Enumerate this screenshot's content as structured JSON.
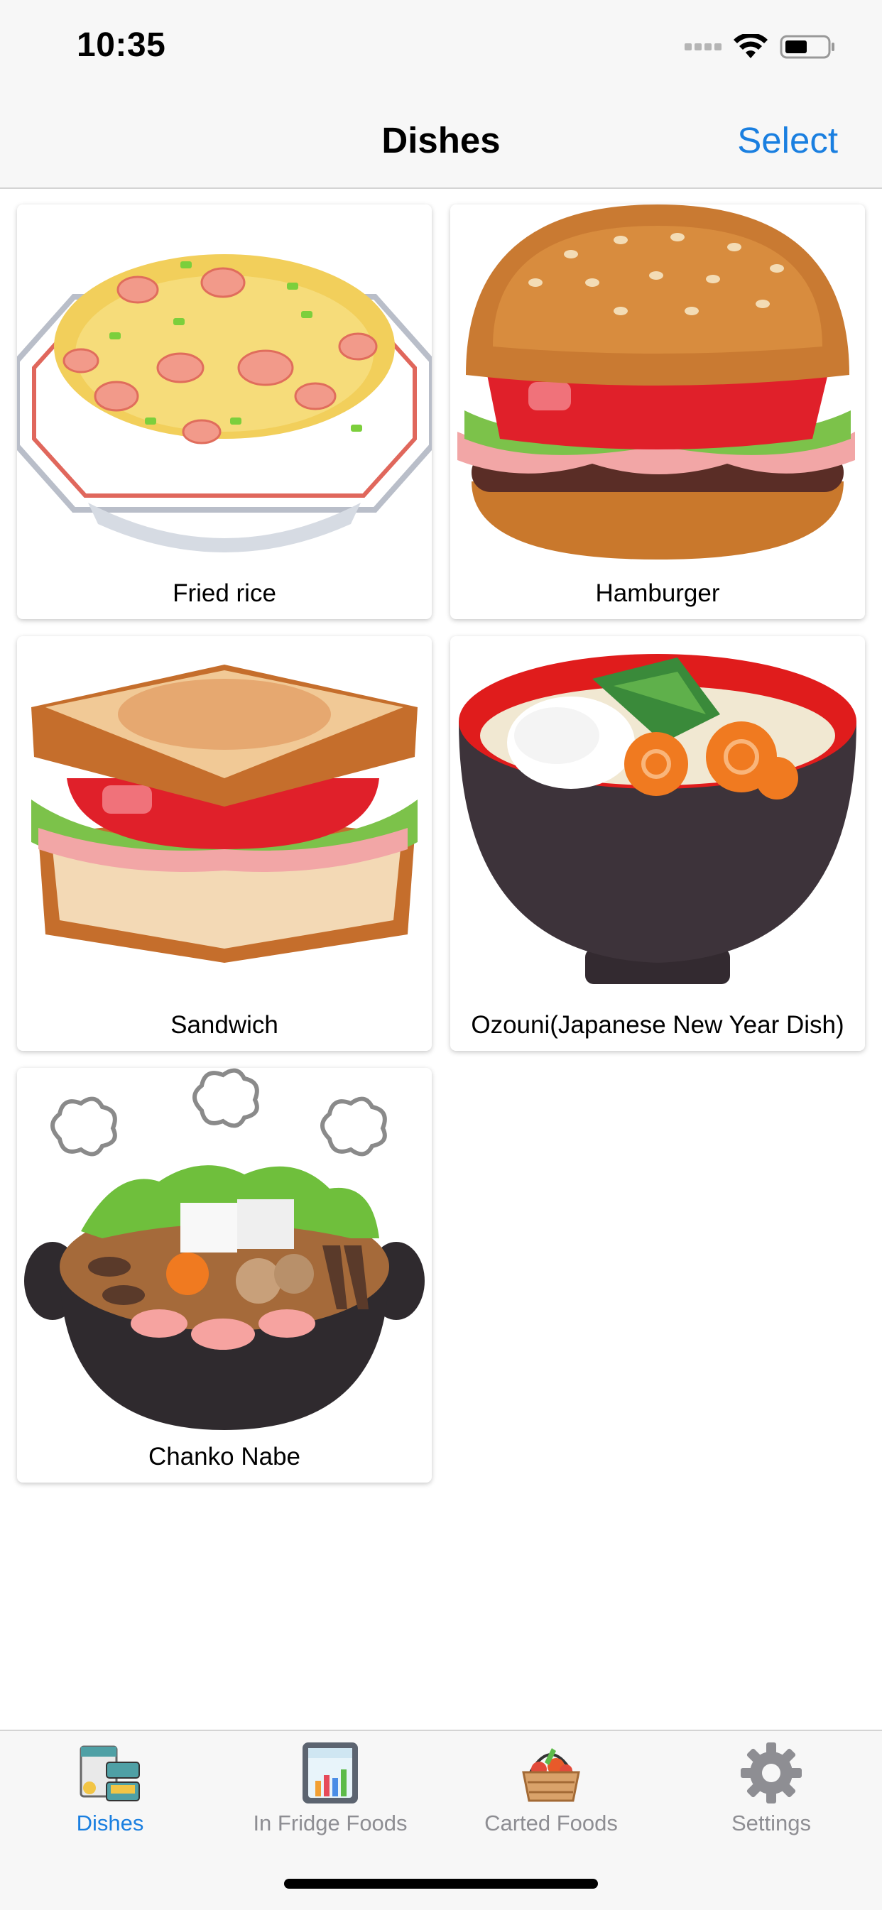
{
  "status_bar": {
    "time": "10:35"
  },
  "nav": {
    "title": "Dishes",
    "select_label": "Select"
  },
  "dishes": [
    {
      "name": "Fried rice",
      "icon": "fried-rice-icon"
    },
    {
      "name": "Hamburger",
      "icon": "hamburger-icon"
    },
    {
      "name": "Sandwich",
      "icon": "sandwich-icon"
    },
    {
      "name": "Ozouni(Japanese New Year Dish)",
      "icon": "ozouni-icon"
    },
    {
      "name": "Chanko Nabe",
      "icon": "chanko-nabe-icon"
    }
  ],
  "tabs": [
    {
      "label": "Dishes",
      "icon": "dishes-tab-icon",
      "active": true
    },
    {
      "label": "In Fridge Foods",
      "icon": "fridge-icon",
      "active": false
    },
    {
      "label": "Carted Foods",
      "icon": "basket-icon",
      "active": false
    },
    {
      "label": "Settings",
      "icon": "gear-icon",
      "active": false
    }
  ],
  "colors": {
    "accent": "#1a7fe0",
    "inactive_tab": "#8e8e93",
    "bar_background": "#f7f7f7"
  }
}
